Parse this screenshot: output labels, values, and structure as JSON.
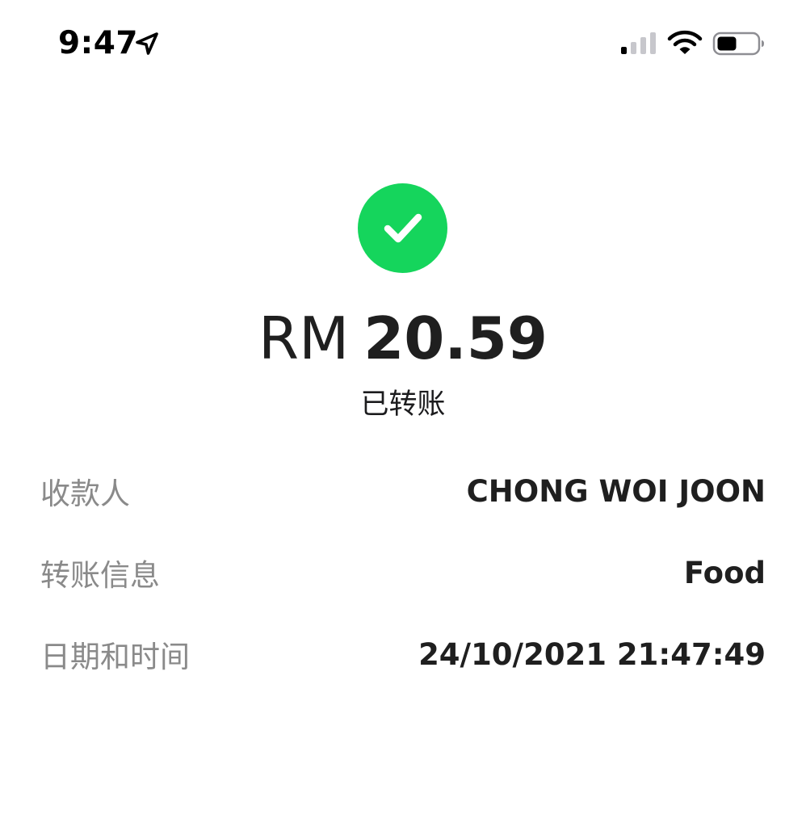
{
  "status_bar": {
    "time": "9:47",
    "icons": [
      "location-arrow-icon",
      "cellular-signal-icon",
      "wifi-icon",
      "battery-icon"
    ]
  },
  "transfer": {
    "status_icon": "checkmark-circle-icon",
    "currency": "RM",
    "amount": "20.59",
    "status": "已转账"
  },
  "details": [
    {
      "label": "收款人",
      "value": "CHONG WOI JOON"
    },
    {
      "label": "转账信息",
      "value": "Food"
    },
    {
      "label": "日期和时间",
      "value": "24/10/2021 21:47:49"
    }
  ],
  "colors": {
    "success": "#15d55c",
    "label": "#8a8a8a",
    "value": "#1f1f1f"
  }
}
